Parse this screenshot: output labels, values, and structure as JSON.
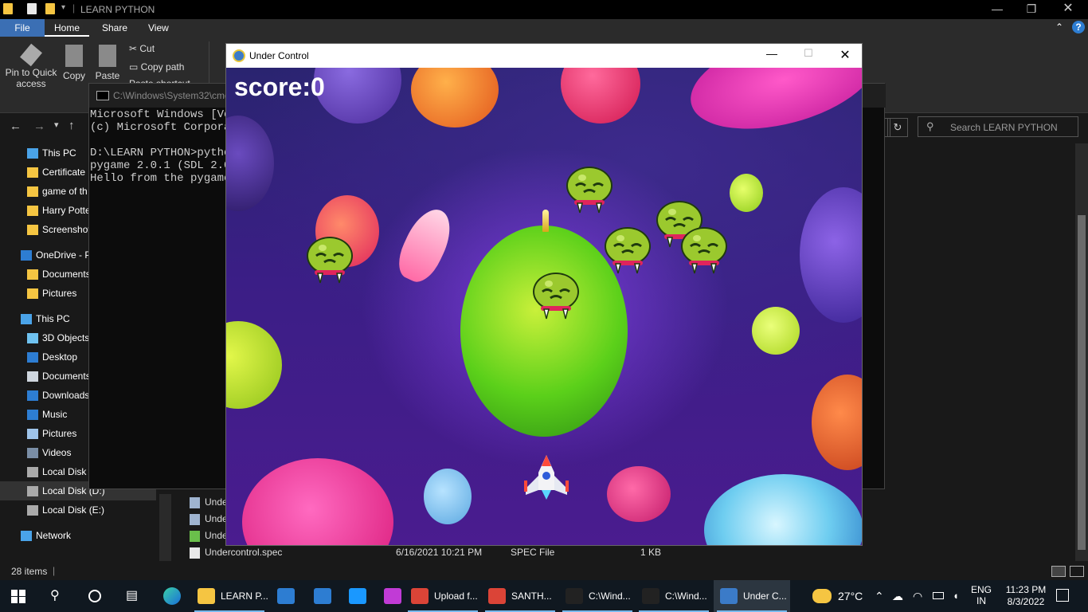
{
  "explorer": {
    "title": "LEARN PYTHON",
    "tabs": [
      "File",
      "Home",
      "Share",
      "View"
    ],
    "ribbon": {
      "pin": "Pin to Quick access",
      "copy": "Copy",
      "paste": "Paste",
      "cut": "Cut",
      "copy_path": "Copy path",
      "paste_shortcut": "Paste shortcut"
    },
    "search_placeholder": "Search LEARN PYTHON",
    "nav": [
      {
        "label": "This PC",
        "icon": "pc-icon"
      },
      {
        "label": "Certificate",
        "icon": "folder-icon"
      },
      {
        "label": "game of th",
        "icon": "folder-icon"
      },
      {
        "label": "Harry Potte",
        "icon": "folder-icon"
      },
      {
        "label": "Screenshot",
        "icon": "folder-icon"
      },
      {
        "label": "OneDrive - P",
        "icon": "cloud-icon"
      },
      {
        "label": "Documents",
        "icon": "folder-icon"
      },
      {
        "label": "Pictures",
        "icon": "folder-icon"
      },
      {
        "label": "This PC",
        "icon": "pc-icon"
      },
      {
        "label": "3D Objects",
        "icon": "cube-icon"
      },
      {
        "label": "Desktop",
        "icon": "desktop-icon"
      },
      {
        "label": "Documents",
        "icon": "document-icon"
      },
      {
        "label": "Downloads",
        "icon": "download-icon"
      },
      {
        "label": "Music",
        "icon": "music-icon"
      },
      {
        "label": "Pictures",
        "icon": "pictures-icon"
      },
      {
        "label": "Videos",
        "icon": "video-icon"
      },
      {
        "label": "Local Disk (",
        "icon": "drive-icon"
      },
      {
        "label": "Local Disk (D:)",
        "icon": "drive-icon"
      },
      {
        "label": "Local Disk (E:)",
        "icon": "drive-icon"
      },
      {
        "label": "Network",
        "icon": "network-icon"
      }
    ],
    "files": [
      {
        "name": "Unde",
        "date": "",
        "type": "",
        "size": ""
      },
      {
        "name": "Unde",
        "date": "",
        "type": "",
        "size": ""
      },
      {
        "name": "Unde",
        "date": "",
        "type": "",
        "size": ""
      },
      {
        "name": "Undercontrol.spec",
        "date": "6/16/2021 10:21 PM",
        "type": "SPEC File",
        "size": "1 KB"
      }
    ],
    "status": "28 items"
  },
  "cmd": {
    "title": "C:\\Windows\\System32\\cmd",
    "lines": [
      "Microsoft Windows [Ve",
      "(c) Microsoft Corpora",
      "",
      "D:\\LEARN PYTHON>pytho",
      "pygame 2.0.1 (SDL 2.0",
      "Hello from the pygame"
    ]
  },
  "game": {
    "title": "Under Control",
    "score": "score:0"
  },
  "taskbar": {
    "items": [
      {
        "label": "LEARN P...",
        "icon": "folder-icon",
        "color": "#f5c542"
      },
      {
        "label": "",
        "icon": "store-icon",
        "color": "#2d7dd2"
      },
      {
        "label": "",
        "icon": "mail-icon",
        "color": "#2d7dd2"
      },
      {
        "label": "",
        "icon": "prime-video-icon",
        "color": "#1a98ff"
      },
      {
        "label": "",
        "icon": "picsart-icon",
        "color": "#c13bd6"
      },
      {
        "label": "Upload f...",
        "icon": "chrome-icon",
        "color": "#db4437"
      },
      {
        "label": "SANTH...",
        "icon": "chrome-icon",
        "color": "#db4437"
      },
      {
        "label": "C:\\Wind...",
        "icon": "cmd-icon",
        "color": "#222"
      },
      {
        "label": "C:\\Wind...",
        "icon": "cmd-icon",
        "color": "#222"
      },
      {
        "label": "Under C...",
        "icon": "python-icon",
        "color": "#3b7bc8"
      }
    ],
    "weather": "27°C",
    "lang": "ENG",
    "region": "IN",
    "time": "11:23 PM",
    "date": "8/3/2022"
  }
}
